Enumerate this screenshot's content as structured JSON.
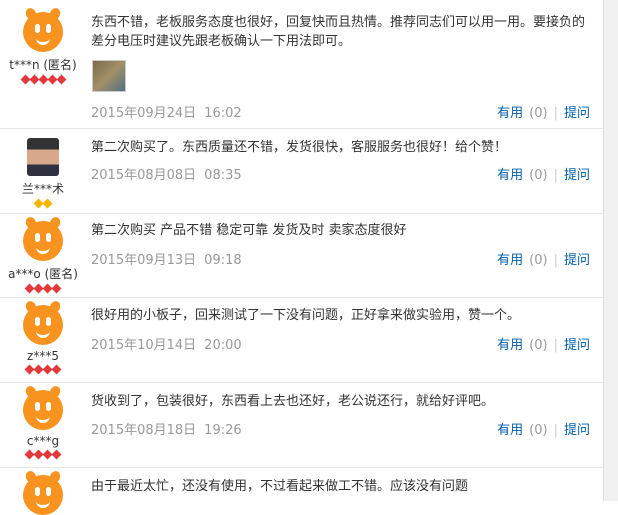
{
  "reviews": [
    {
      "user": "t***n (匿名)",
      "avatar": "orange-mascot-avatar",
      "badge_color": "#e4393c",
      "badge_count": 5,
      "content": "东西不错，老板服务态度也很好，回复快而且热情。推荐同志们可以用一用。要接负的差分电压时建议先跟老板确认一下用法即可。",
      "has_photo": true,
      "date": "2015年09月24日",
      "time": "16:02",
      "useful_label": "有用",
      "useful_count": "(0)",
      "ask_label": "提问"
    },
    {
      "user": "兰***术",
      "avatar": "user-photo-avatar",
      "badge_color": "#f5b400",
      "badge_count": 2,
      "content": "第二次购买了。东西质量还不错，发货很快，客服服务也很好！给个赞！",
      "date": "2015年08月08日",
      "time": "08:35",
      "useful_label": "有用",
      "useful_count": "(0)",
      "ask_label": "提问"
    },
    {
      "user": "a***o (匿名)",
      "avatar": "orange-mascot-avatar",
      "badge_color": "#e4393c",
      "badge_count": 4,
      "content": "第二次购买 产品不错 稳定可靠 发货及时 卖家态度很好",
      "date": "2015年09月13日",
      "time": "09:18",
      "useful_label": "有用",
      "useful_count": "(0)",
      "ask_label": "提问"
    },
    {
      "user": "z***5",
      "avatar": "orange-mascot-avatar",
      "badge_color": "#e4393c",
      "badge_count": 4,
      "content": "很好用的小板子，回来测试了一下没有问题，正好拿来做实验用，赞一个。",
      "date": "2015年10月14日",
      "time": "20:00",
      "useful_label": "有用",
      "useful_count": "(0)",
      "ask_label": "提问"
    },
    {
      "user": "c***g",
      "avatar": "orange-mascot-avatar",
      "badge_color": "#e4393c",
      "badge_count": 4,
      "content": "货收到了，包装很好，东西看上去也还好，老公说还行，就给好评吧。",
      "date": "2015年08月18日",
      "time": "19:26",
      "useful_label": "有用",
      "useful_count": "(0)",
      "ask_label": "提问"
    },
    {
      "user": "",
      "avatar": "orange-mascot-avatar",
      "content": "由于最近太忙，还没有使用，不过看起来做工不错。应该没有问题"
    }
  ]
}
